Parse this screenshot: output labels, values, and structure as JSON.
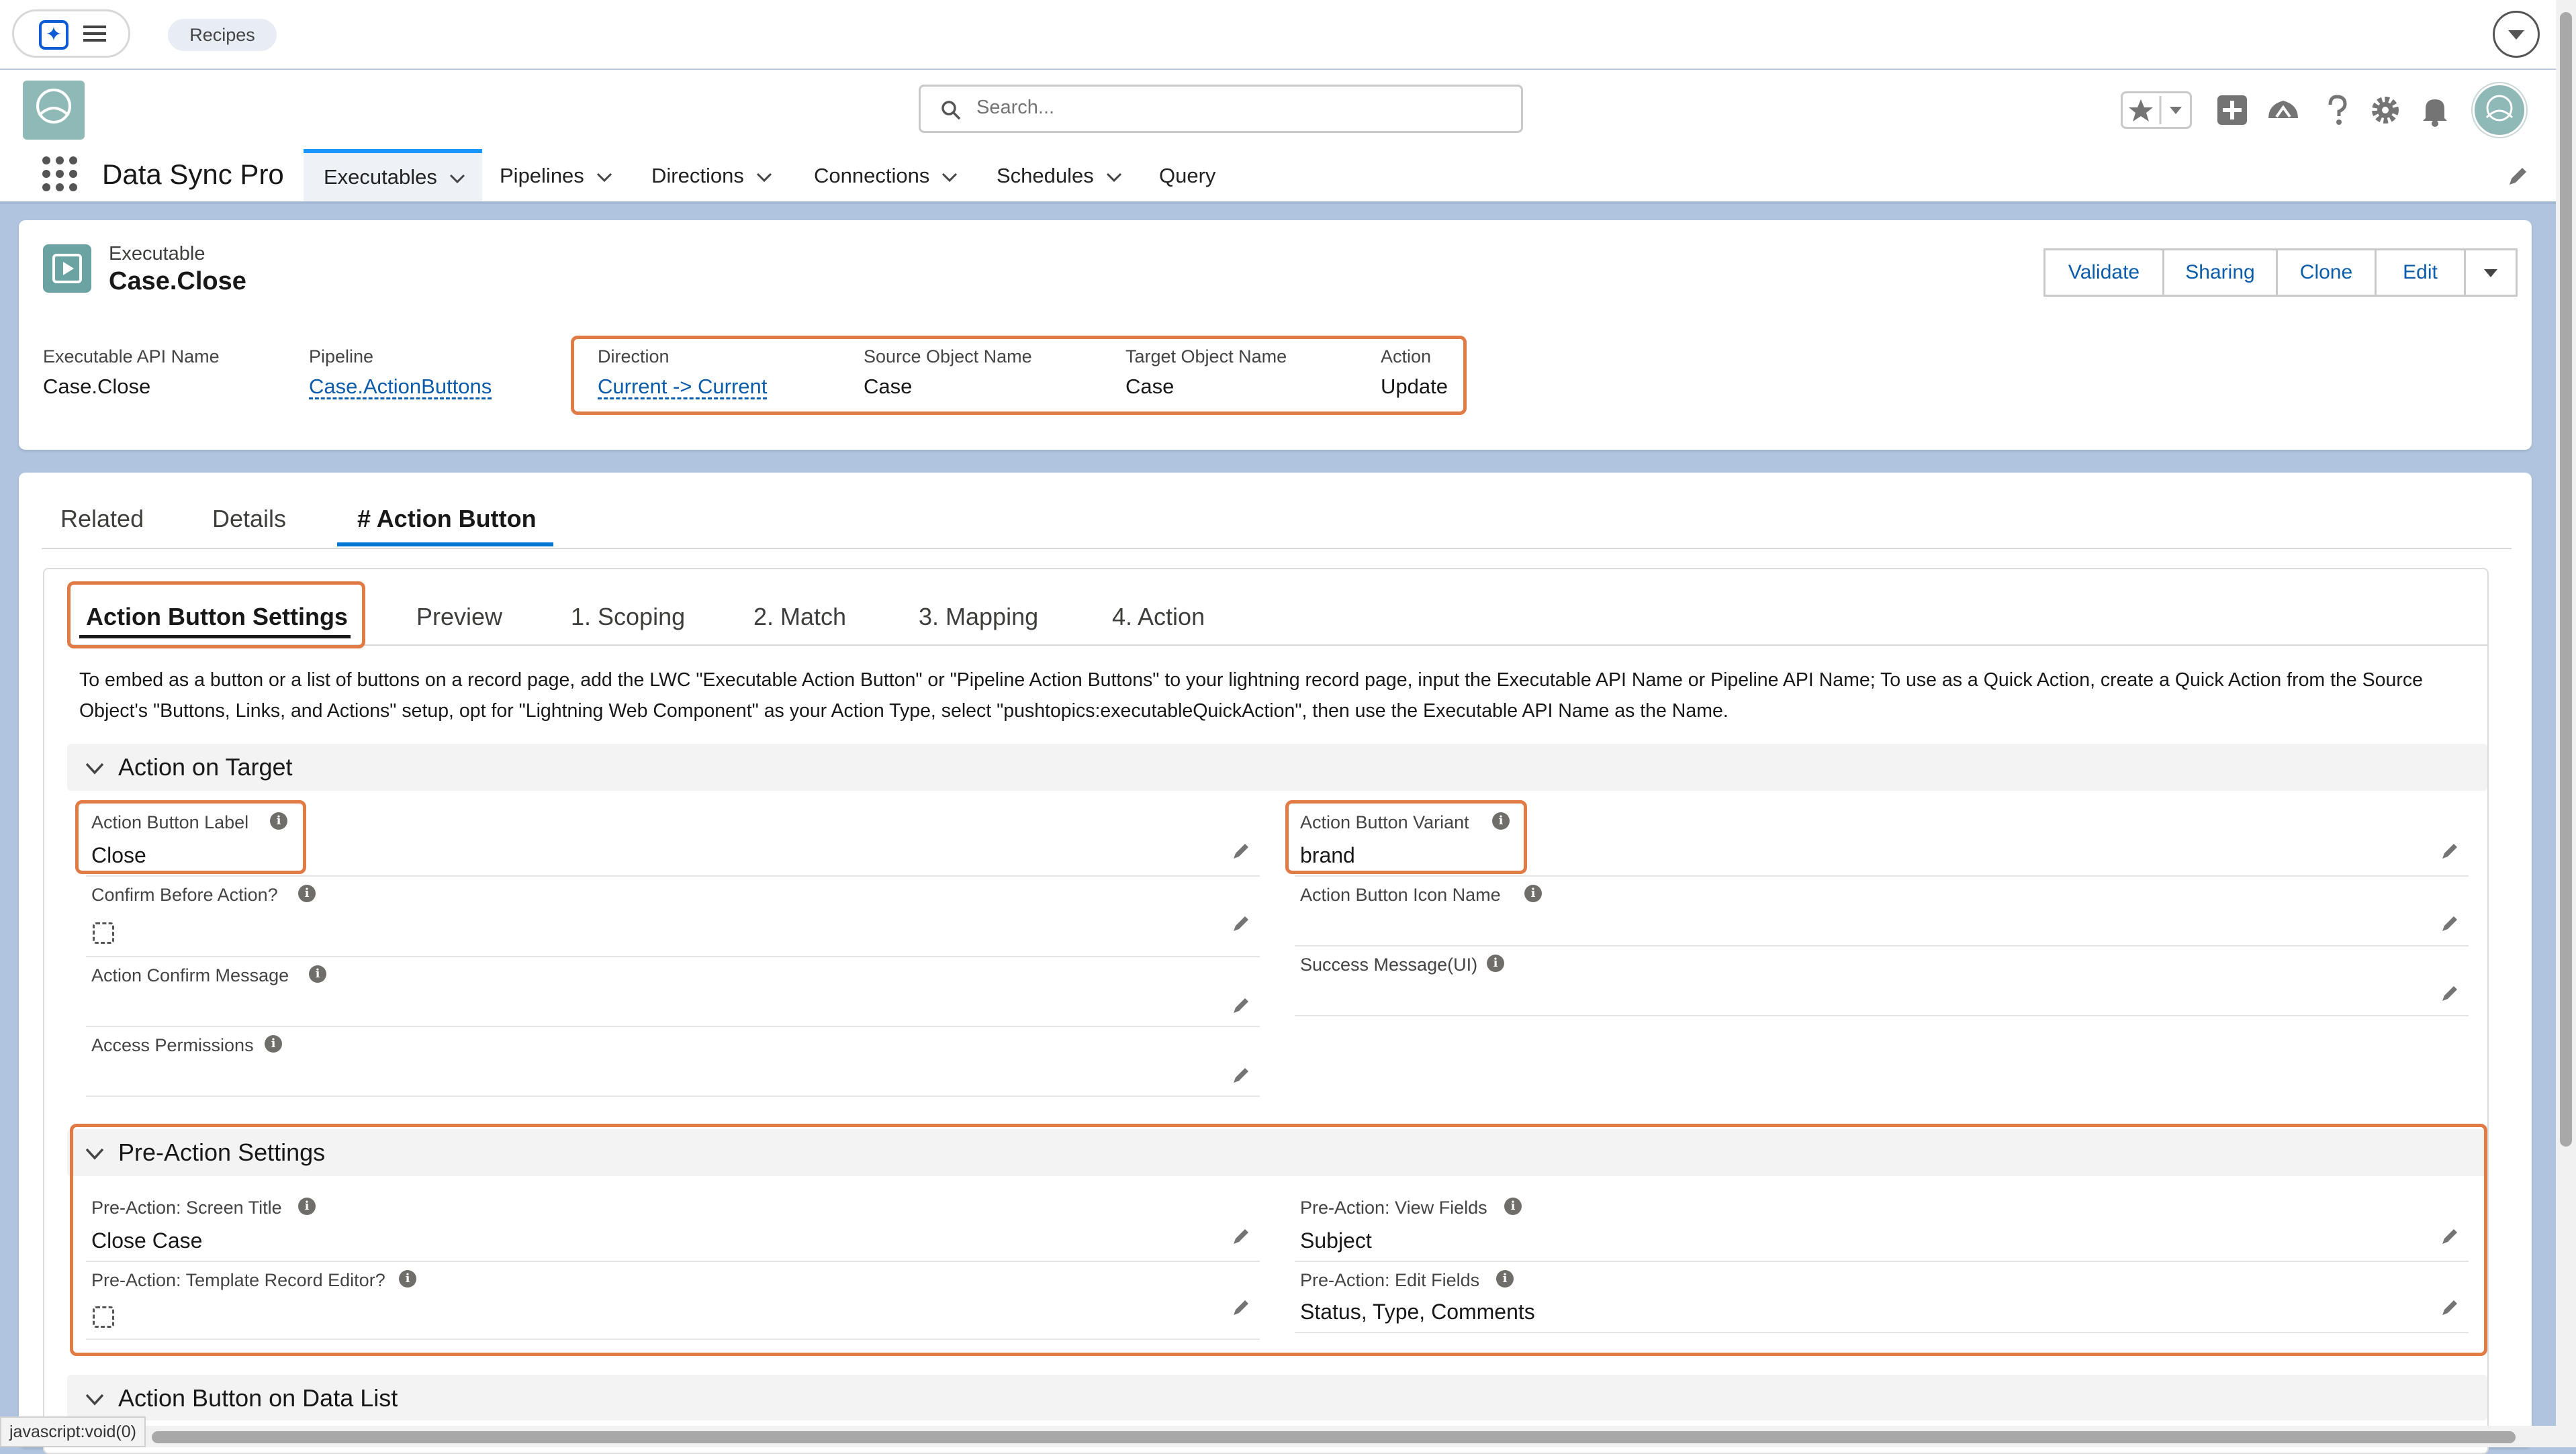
{
  "topbar": {
    "recipes_label": "Recipes"
  },
  "search": {
    "placeholder": "Search..."
  },
  "nav": {
    "app_name": "Data Sync Pro",
    "items": [
      "Executables",
      "Pipelines",
      "Directions",
      "Connections",
      "Schedules",
      "Query"
    ],
    "active": "Executables"
  },
  "record": {
    "type_label": "Executable",
    "title": "Case.Close",
    "actions": [
      "Validate",
      "Sharing",
      "Clone",
      "Edit"
    ],
    "highlights": [
      {
        "label": "Executable API Name",
        "value": "Case.Close",
        "link": false
      },
      {
        "label": "Pipeline",
        "value": "Case.ActionButtons",
        "link": true
      },
      {
        "label": "Direction",
        "value": "Current -> Current",
        "link": true
      },
      {
        "label": "Source Object Name",
        "value": "Case",
        "link": false
      },
      {
        "label": "Target Object Name",
        "value": "Case",
        "link": false
      },
      {
        "label": "Action",
        "value": "Update",
        "link": false
      }
    ]
  },
  "record_tabs": [
    "Related",
    "Details",
    "# Action Button"
  ],
  "sub_tabs": [
    "Action Button Settings",
    "Preview",
    "1. Scoping",
    "2. Match",
    "3. Mapping",
    "4. Action"
  ],
  "instructions": "To embed as a button or a list of buttons on a record page, add the LWC \"Executable Action Button\" or \"Pipeline Action Buttons\" to your lightning record page, input the Executable API Name or Pipeline API Name; To use as a Quick Action, create a Quick Action from the Source Object's \"Buttons, Links, and Actions\" setup, opt for \"Lightning Web Component\" as your Action Type, select \"pushtopics:executableQuickAction\", then use the Executable API Name as the Name.",
  "section_action_on_target": {
    "title": "Action on Target",
    "left": [
      {
        "label": "Action Button Label",
        "value": "Close"
      },
      {
        "label": "Confirm Before Action?",
        "value": ""
      },
      {
        "label": "Action Confirm Message",
        "value": ""
      },
      {
        "label": "Access Permissions",
        "value": ""
      }
    ],
    "right": [
      {
        "label": "Action Button Variant",
        "value": "brand"
      },
      {
        "label": "Action Button Icon Name",
        "value": ""
      },
      {
        "label": "Success Message(UI)",
        "value": ""
      }
    ]
  },
  "section_pre_action": {
    "title": "Pre-Action Settings",
    "left": [
      {
        "label": "Pre-Action: Screen Title",
        "value": "Close Case"
      },
      {
        "label": "Pre-Action: Template Record Editor?",
        "value": ""
      }
    ],
    "right": [
      {
        "label": "Pre-Action: View Fields",
        "value": "Subject"
      },
      {
        "label": "Pre-Action: Edit Fields",
        "value": "Status, Type, Comments"
      }
    ]
  },
  "section_data_list": {
    "title": "Action Button on Data List"
  },
  "status_bar": {
    "url": "javascript:void(0)"
  },
  "colors": {
    "accent": "#0176d3",
    "highlight": "#e07b45",
    "link": "#0b5cab"
  }
}
